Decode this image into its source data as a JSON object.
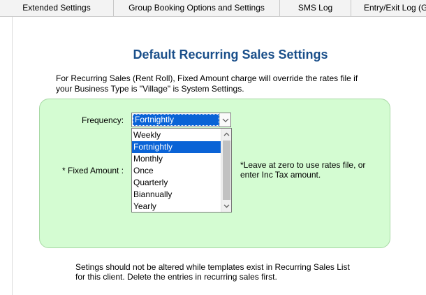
{
  "tabs": [
    {
      "label": "Extended Settings"
    },
    {
      "label": "Group Booking Options and Settings"
    },
    {
      "label": "SMS Log"
    },
    {
      "label": "Entry/Exit Log (G"
    }
  ],
  "page": {
    "title": "Default Recurring Sales Settings",
    "description_line1": "For Recurring Sales (Rent Roll), Fixed Amount charge will override the rates file if",
    "description_line2": "your Business Type is \"Village\" is System Settings."
  },
  "form": {
    "frequency_label": "Frequency:",
    "frequency_selected": "Fortnightly",
    "frequency_options": [
      "Weekly",
      "Fortnightly",
      "Monthly",
      "Once",
      "Quarterly",
      "Biannually",
      "Yearly"
    ],
    "fixed_amount_label": "* Fixed Amount :",
    "note_line1": "*Leave at zero to use rates file, or",
    "note_line2": "enter Inc Tax amount."
  },
  "footer": {
    "line1": "Setings should not be altered while templates exist in Recurring Sales List",
    "line2": "for this client. Delete the entries in recurring sales first."
  },
  "colors": {
    "title": "#1a4f8a",
    "panel_background": "#d4fcd2",
    "selection": "#0a63d6"
  }
}
